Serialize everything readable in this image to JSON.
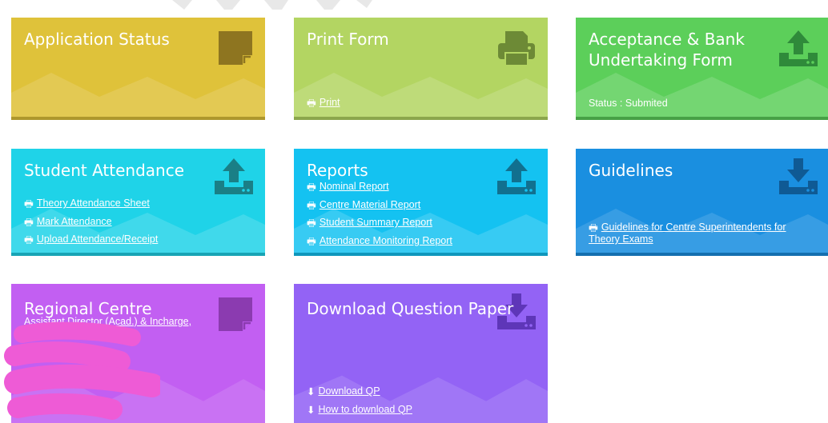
{
  "colors": {
    "application_status": "#dfc23a",
    "print_form": "#b3d562",
    "acceptance": "#5ccf5a",
    "student_attendance": "#1fd3e8",
    "reports": "#14c2f1",
    "guidelines": "#1a8fe0",
    "regional_centre": "#c25ff2",
    "download_qp": "#9363f5",
    "redaction": "#ee5bd6"
  },
  "cards": {
    "application_status": {
      "title": "Application Status",
      "icon": "note-icon"
    },
    "print_form": {
      "title": "Print Form",
      "icon": "printer-icon",
      "print_link": "Print"
    },
    "acceptance": {
      "title_line1": "Acceptance & Bank",
      "title_line2": "Undertaking Form",
      "icon": "upload-icon",
      "status": "Status : Submited"
    },
    "student_attendance": {
      "title": "Student Attendance",
      "icon": "upload-icon",
      "links": [
        "Theory Attendance Sheet",
        "Mark Attendance",
        "Upload Attendance/Receipt"
      ]
    },
    "reports": {
      "title": "Reports",
      "icon": "upload-icon",
      "links": [
        "Nominal Report",
        "Centre Material Report",
        "Student Summary Report",
        "Attendance Monitoring Report"
      ]
    },
    "guidelines": {
      "title": "Guidelines",
      "icon": "download-icon",
      "link_line1": "Guidelines for Centre Superintendents for",
      "link_line2": "Theory Exams"
    },
    "regional_centre": {
      "title": "Regional Centre",
      "icon": "note-icon",
      "subtitle": "Assistant Director (Acad.) & Incharge,"
    },
    "download_qp": {
      "title": "Download Question Paper",
      "icon": "download-icon",
      "links": [
        "Download QP",
        "How to download QP"
      ]
    }
  }
}
